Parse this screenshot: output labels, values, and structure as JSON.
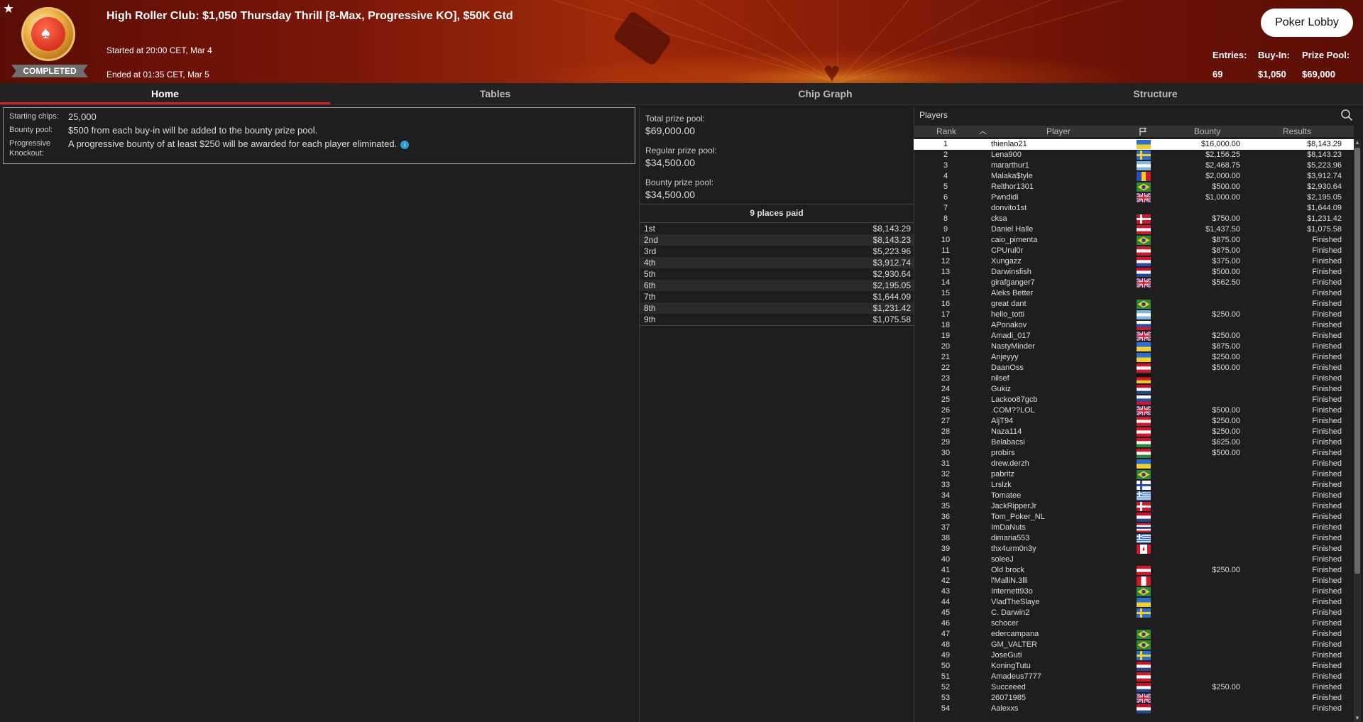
{
  "header": {
    "title": "High Roller Club: $1,050 Thursday Thrill [8-Max, Progressive KO], $50K Gtd",
    "started": "Started at 20:00 CET, Mar 4",
    "ended": "Ended at 01:35 CET, Mar 5",
    "status": "COMPLETED",
    "lobby_button": "Poker Lobby",
    "entries_label": "Entries:",
    "entries_value": "69",
    "buyin_label": "Buy-In:",
    "buyin_value": "$1,050",
    "prizepool_label": "Prize Pool:",
    "prizepool_value": "$69,000"
  },
  "tabs": [
    "Home",
    "Tables",
    "Chip Graph",
    "Structure"
  ],
  "info": {
    "starting_chips_label": "Starting chips:",
    "starting_chips_value": "25,000",
    "bounty_pool_label": "Bounty pool:",
    "bounty_pool_value": "$500 from each buy-in will be added to the bounty prize pool.",
    "pko_label_1": "Progressive",
    "pko_label_2": "Knockout:",
    "pko_value": "A progressive bounty of at least $250 will be awarded for each player eliminated."
  },
  "prize": {
    "total_label": "Total prize pool:",
    "total_value": "$69,000.00",
    "regular_label": "Regular prize pool:",
    "regular_value": "$34,500.00",
    "bounty_label": "Bounty prize pool:",
    "bounty_value": "$34,500.00",
    "places_paid": "9 places paid",
    "payouts": [
      {
        "place": "1st",
        "amount": "$8,143.29"
      },
      {
        "place": "2nd",
        "amount": "$8,143.23"
      },
      {
        "place": "3rd",
        "amount": "$5,223.96"
      },
      {
        "place": "4th",
        "amount": "$3,912.74"
      },
      {
        "place": "5th",
        "amount": "$2,930.64"
      },
      {
        "place": "6th",
        "amount": "$2,195.05"
      },
      {
        "place": "7th",
        "amount": "$1,644.09"
      },
      {
        "place": "8th",
        "amount": "$1,231.42"
      },
      {
        "place": "9th",
        "amount": "$1,075.58"
      }
    ]
  },
  "players": {
    "title": "Players",
    "columns": {
      "rank": "Rank",
      "player": "Player",
      "bounty": "Bounty",
      "results": "Results"
    },
    "rows": [
      {
        "rank": "1",
        "name": "thienlao21",
        "flag": "ua",
        "bounty": "$16,000.00",
        "result": "$8,143.29"
      },
      {
        "rank": "2",
        "name": "Lena900",
        "flag": "se",
        "bounty": "$2,156.25",
        "result": "$8,143.23"
      },
      {
        "rank": "3",
        "name": "mararthur1",
        "flag": "ar",
        "bounty": "$2,468.75",
        "result": "$5,223.96"
      },
      {
        "rank": "4",
        "name": "Malaka$tyle",
        "flag": "md",
        "bounty": "$2,000.00",
        "result": "$3,912.74"
      },
      {
        "rank": "5",
        "name": "Relthor1301",
        "flag": "br",
        "bounty": "$500.00",
        "result": "$2,930.64"
      },
      {
        "rank": "6",
        "name": "Pwndidi",
        "flag": "gb",
        "bounty": "$1,000.00",
        "result": "$2,195.05"
      },
      {
        "rank": "7",
        "name": "donvito1st",
        "flag": "",
        "bounty": "",
        "result": "$1,644.09"
      },
      {
        "rank": "8",
        "name": "cksa",
        "flag": "dk",
        "bounty": "$750.00",
        "result": "$1,231.42"
      },
      {
        "rank": "9",
        "name": "Daniel Halle",
        "flag": "at",
        "bounty": "$1,437.50",
        "result": "$1,075.58"
      },
      {
        "rank": "10",
        "name": "caio_pimenta",
        "flag": "br",
        "bounty": "$875.00",
        "result": "Finished"
      },
      {
        "rank": "11",
        "name": "CPUrul0r",
        "flag": "at",
        "bounty": "$875.00",
        "result": "Finished"
      },
      {
        "rank": "12",
        "name": "Xungazz",
        "flag": "hr",
        "bounty": "$375.00",
        "result": "Finished"
      },
      {
        "rank": "13",
        "name": "Darwinsfish",
        "flag": "nl",
        "bounty": "$500.00",
        "result": "Finished"
      },
      {
        "rank": "14",
        "name": "girafganger7",
        "flag": "gb",
        "bounty": "$562.50",
        "result": "Finished"
      },
      {
        "rank": "15",
        "name": "Aleks Better",
        "flag": "",
        "bounty": "",
        "result": "Finished"
      },
      {
        "rank": "16",
        "name": "great dant",
        "flag": "br",
        "bounty": "",
        "result": "Finished"
      },
      {
        "rank": "17",
        "name": "hello_totti",
        "flag": "ar",
        "bounty": "$250.00",
        "result": "Finished"
      },
      {
        "rank": "18",
        "name": "APonakov",
        "flag": "ru",
        "bounty": "",
        "result": "Finished"
      },
      {
        "rank": "19",
        "name": "Amadi_017",
        "flag": "gb",
        "bounty": "$250.00",
        "result": "Finished"
      },
      {
        "rank": "20",
        "name": "NastyMinder",
        "flag": "ua",
        "bounty": "$875.00",
        "result": "Finished"
      },
      {
        "rank": "21",
        "name": "Anjeyyy",
        "flag": "ua",
        "bounty": "$250.00",
        "result": "Finished"
      },
      {
        "rank": "22",
        "name": "DaanOss",
        "flag": "at",
        "bounty": "$500.00",
        "result": "Finished"
      },
      {
        "rank": "23",
        "name": "nilsef",
        "flag": "de",
        "bounty": "",
        "result": "Finished"
      },
      {
        "rank": "24",
        "name": "Gukiz",
        "flag": "nl",
        "bounty": "",
        "result": "Finished"
      },
      {
        "rank": "25",
        "name": "Lackoo87gcb",
        "flag": "si",
        "bounty": "",
        "result": "Finished"
      },
      {
        "rank": "26",
        "name": ".COM??LOL",
        "flag": "gb",
        "bounty": "$500.00",
        "result": "Finished"
      },
      {
        "rank": "27",
        "name": "AljT94",
        "flag": "at",
        "bounty": "$250.00",
        "result": "Finished"
      },
      {
        "rank": "28",
        "name": "Naza114",
        "flag": "at",
        "bounty": "$250.00",
        "result": "Finished"
      },
      {
        "rank": "29",
        "name": "Belabacsi",
        "flag": "hu",
        "bounty": "$625.00",
        "result": "Finished"
      },
      {
        "rank": "30",
        "name": "probirs",
        "flag": "hu",
        "bounty": "$500.00",
        "result": "Finished"
      },
      {
        "rank": "31",
        "name": "drew.derzh",
        "flag": "ua",
        "bounty": "",
        "result": "Finished"
      },
      {
        "rank": "32",
        "name": "pabritz",
        "flag": "br",
        "bounty": "",
        "result": "Finished"
      },
      {
        "rank": "33",
        "name": "Lrslzk",
        "flag": "fi",
        "bounty": "",
        "result": "Finished"
      },
      {
        "rank": "34",
        "name": "Tomatee",
        "flag": "gr",
        "bounty": "",
        "result": "Finished"
      },
      {
        "rank": "35",
        "name": "JackRipperJr",
        "flag": "dk",
        "bounty": "",
        "result": "Finished"
      },
      {
        "rank": "36",
        "name": "Tom_Poker_NL",
        "flag": "nl",
        "bounty": "",
        "result": "Finished"
      },
      {
        "rank": "37",
        "name": "ImDaNuts",
        "flag": "th",
        "bounty": "",
        "result": "Finished"
      },
      {
        "rank": "38",
        "name": "dimaria553",
        "flag": "gr",
        "bounty": "",
        "result": "Finished"
      },
      {
        "rank": "39",
        "name": "thx4urm0n3y",
        "flag": "ca",
        "bounty": "",
        "result": "Finished"
      },
      {
        "rank": "40",
        "name": "soleeJ",
        "flag": "",
        "bounty": "",
        "result": "Finished"
      },
      {
        "rank": "41",
        "name": "Old brock",
        "flag": "at",
        "bounty": "$250.00",
        "result": "Finished"
      },
      {
        "rank": "42",
        "name": "l'MalliN.3lli",
        "flag": "pe",
        "bounty": "",
        "result": "Finished"
      },
      {
        "rank": "43",
        "name": "Internett93o",
        "flag": "br",
        "bounty": "",
        "result": "Finished"
      },
      {
        "rank": "44",
        "name": "VladTheSlaye",
        "flag": "ua",
        "bounty": "",
        "result": "Finished"
      },
      {
        "rank": "45",
        "name": "C. Darwin2",
        "flag": "se",
        "bounty": "",
        "result": "Finished"
      },
      {
        "rank": "46",
        "name": "schocer",
        "flag": "",
        "bounty": "",
        "result": "Finished"
      },
      {
        "rank": "47",
        "name": "edercampana",
        "flag": "br",
        "bounty": "",
        "result": "Finished"
      },
      {
        "rank": "48",
        "name": "GM_VALTER",
        "flag": "br",
        "bounty": "",
        "result": "Finished"
      },
      {
        "rank": "49",
        "name": "JoseGuti",
        "flag": "se",
        "bounty": "",
        "result": "Finished"
      },
      {
        "rank": "50",
        "name": "KoningTutu",
        "flag": "nl",
        "bounty": "",
        "result": "Finished"
      },
      {
        "rank": "51",
        "name": "Amadeus7777",
        "flag": "at",
        "bounty": "",
        "result": "Finished"
      },
      {
        "rank": "52",
        "name": "Succeeed",
        "flag": "nl",
        "bounty": "$250.00",
        "result": "Finished"
      },
      {
        "rank": "53",
        "name": "26071985",
        "flag": "gb",
        "bounty": "",
        "result": "Finished"
      },
      {
        "rank": "54",
        "name": "Aalexxs",
        "flag": "nl",
        "bounty": "",
        "result": "Finished"
      }
    ]
  },
  "colors": {
    "accent": "#d4202f",
    "panel": "#1e1e1e",
    "header_red": "#8c1e08",
    "info_icon": "#2b9bd9"
  }
}
